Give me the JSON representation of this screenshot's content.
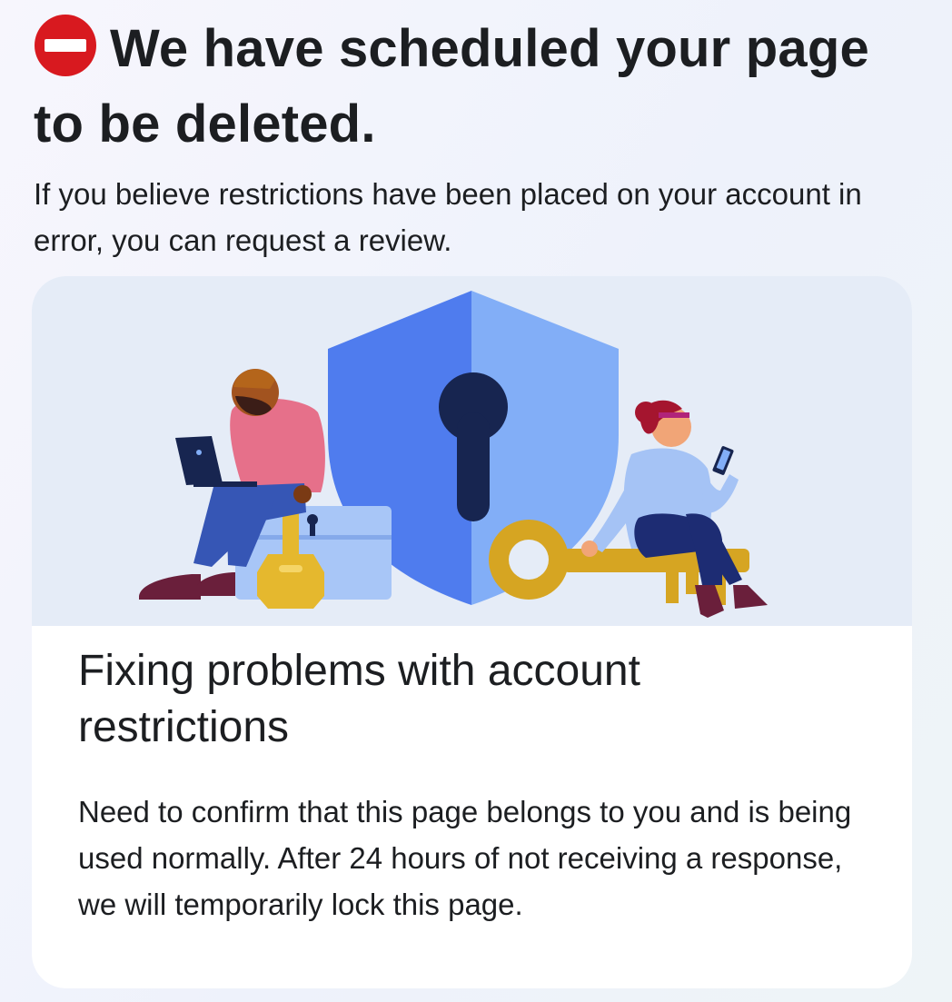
{
  "header": {
    "icon": "stop-icon",
    "title": "We have scheduled your page to be deleted.",
    "subtitle": "If you believe restrictions have been placed on your account in error, you can request a review."
  },
  "card": {
    "illustration": "account-security-illustration",
    "title": "Fixing problems with account restrictions",
    "body": "Need to confirm that this page belongs to you and is being used normally. After 24 hours of not receiving a response, we will temporarily lock this page."
  },
  "colors": {
    "stop_red": "#d8191f",
    "shield_blue": "#4f7cee",
    "key_gold": "#e5b82e",
    "card_bg": "#ffffff",
    "illustration_bg": "#e5ecf7"
  }
}
